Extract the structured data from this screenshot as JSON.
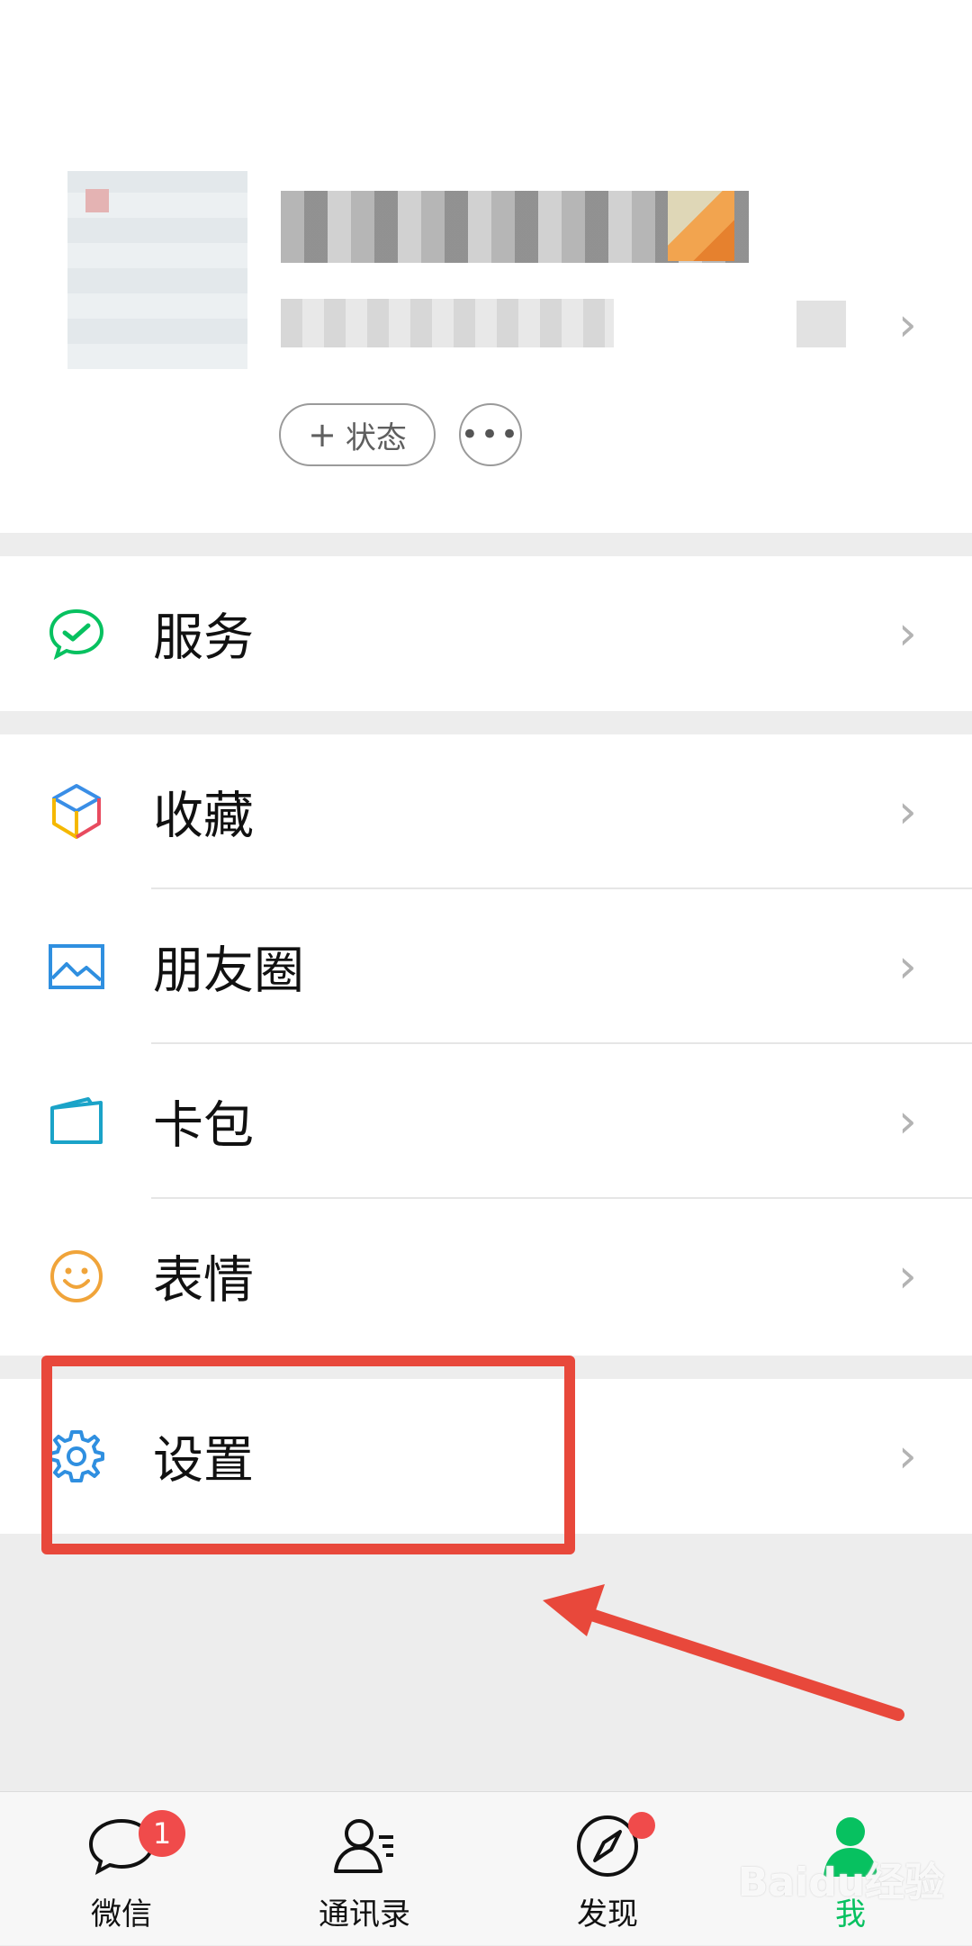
{
  "profile": {
    "status_label": "状态",
    "more_label": "•••"
  },
  "menu": {
    "service": "服务",
    "favorites": "收藏",
    "moments": "朋友圈",
    "cards": "卡包",
    "stickers": "表情",
    "settings": "设置"
  },
  "tabs": [
    {
      "label": "微信",
      "badge": "1"
    },
    {
      "label": "通讯录"
    },
    {
      "label": "发现"
    },
    {
      "label": "我"
    }
  ],
  "colors": {
    "accent_green": "#07c160",
    "badge_red": "#f04b4b",
    "highlight_red": "#e8483b"
  },
  "watermark": "Baidu经验"
}
